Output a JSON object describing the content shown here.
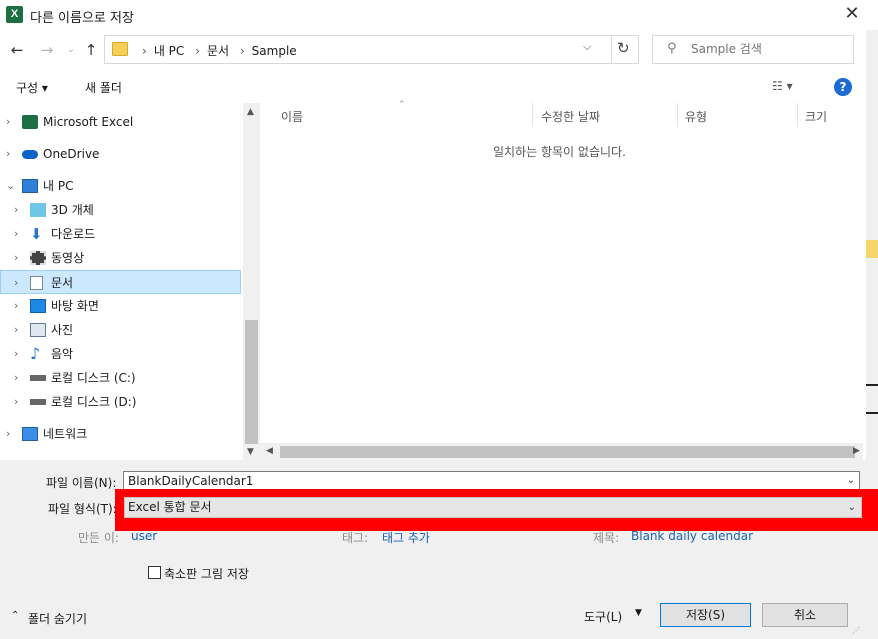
{
  "window": {
    "title": "다른 이름으로 저장",
    "app_icon_letter": "X",
    "close_glyph": "✕"
  },
  "address": {
    "crumbs": [
      "내 PC",
      "문서",
      "Sample"
    ],
    "search_placeholder": "Sample 검색"
  },
  "toolbar": {
    "organize": "구성 ▾",
    "new_folder": "새 폴더"
  },
  "nav": {
    "items": [
      {
        "label": "Microsoft Excel",
        "icon": "excel-icon"
      },
      {
        "label": "OneDrive",
        "icon": "cloud-icon"
      },
      {
        "label": "내 PC",
        "icon": "computer-icon"
      },
      {
        "label": "3D 개체",
        "icon": "cube-icon"
      },
      {
        "label": "다운로드",
        "icon": "download-icon"
      },
      {
        "label": "동영상",
        "icon": "video-icon"
      },
      {
        "label": "문서",
        "icon": "document-icon"
      },
      {
        "label": "바탕 화면",
        "icon": "desktop-icon"
      },
      {
        "label": "사진",
        "icon": "picture-icon"
      },
      {
        "label": "음악",
        "icon": "music-icon"
      },
      {
        "label": "로컬 디스크 (C:)",
        "icon": "drive-icon"
      },
      {
        "label": "로컬 디스크 (D:)",
        "icon": "drive-icon"
      },
      {
        "label": "네트워크",
        "icon": "network-icon"
      }
    ],
    "selected": "문서"
  },
  "file_list": {
    "columns": [
      "이름",
      "수정한 날짜",
      "유형",
      "크기"
    ],
    "empty_message": "일치하는 항목이 없습니다."
  },
  "form": {
    "filename_label": "파일 이름(N):",
    "filename_value": "BlankDailyCalendar1",
    "filetype_label": "파일 형식(T):",
    "filetype_value": "Excel 통합 문서",
    "author_label": "만든 이:",
    "author_value": "user",
    "tags_label": "태그:",
    "tags_value": "태그 추가",
    "title_label": "제목:",
    "title_value": "Blank daily calendar",
    "thumbnail_label": "축소판 그림 저장"
  },
  "footer": {
    "hide_folders": "폴더 숨기기",
    "tools": "도구(L)",
    "save": "저장(S)",
    "cancel": "취소"
  },
  "colors": {
    "highlight": "#ff0000",
    "selection": "#cce8ff",
    "excel_green": "#1d6f42",
    "link_blue": "#1a5fb4"
  }
}
